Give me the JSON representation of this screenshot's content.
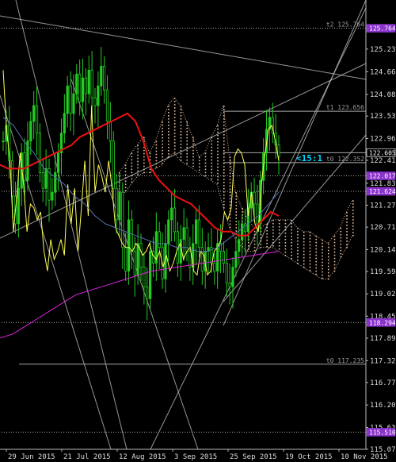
{
  "chart_data": {
    "type": "candlestick",
    "xlabel": "",
    "ylabel": "",
    "ylim": [
      115.075,
      126.4
    ],
    "y_ticks": [
      "125.235",
      "124.660",
      "124.085",
      "123.535",
      "122.965",
      "122.410",
      "121.830",
      "121.270",
      "120.715",
      "120.145",
      "119.590",
      "119.020",
      "118.455",
      "117.895",
      "117.325",
      "116.770",
      "116.200",
      "115.630",
      "115.075"
    ],
    "x_ticks": [
      "29 Jun 2015",
      "21 Jul 2015",
      "12 Aug 2015",
      "3 Sep 2015",
      "25 Sep 2015",
      "19 Oct 2015",
      "10 Nov 2015"
    ],
    "price_tags": [
      {
        "value": 125.764,
        "text": "125.764",
        "color": "#8b33cc"
      },
      {
        "value": 122.605,
        "text": "122.605",
        "color": "#000000"
      },
      {
        "value": 122.017,
        "text": "122.017",
        "color": "#8b33cc"
      },
      {
        "value": 121.624,
        "text": "121.624",
        "color": "#8b33cc"
      },
      {
        "value": 118.294,
        "text": "118.294",
        "color": "#8b33cc"
      },
      {
        "value": 115.51,
        "text": "115.510",
        "color": "#8b33cc"
      }
    ],
    "hlines": [
      {
        "value": 125.764,
        "label": "t2 125.764",
        "style": "dotted"
      },
      {
        "value": 123.656,
        "label": "t1 123.656",
        "style": "solid"
      },
      {
        "value": 122.605,
        "label": "",
        "style": "solid"
      },
      {
        "value": 122.352,
        "label": "t0 122.352",
        "style": "solid"
      },
      {
        "value": 122.017,
        "label": "",
        "style": "dotted"
      },
      {
        "value": 121.624,
        "label": "",
        "style": "dotted"
      },
      {
        "value": 118.294,
        "label": "",
        "style": "dotted"
      },
      {
        "value": 117.235,
        "label": "t0 117.235",
        "style": "solid"
      },
      {
        "value": 115.51,
        "label": "",
        "style": "dotted"
      }
    ],
    "annotation": {
      "text": "<15:1",
      "value": 122.45,
      "color": "#00d8ff"
    },
    "series": [
      {
        "kind": "candles",
        "color": "#22cc22",
        "close": [
          122.9,
          123.3,
          122.4,
          121.5,
          120.8,
          121.7,
          122.6,
          121.9,
          122.9,
          123.4,
          123.8,
          123.1,
          122.1,
          121.7,
          122.2,
          121.4,
          121.6,
          122.1,
          122.6,
          123.1,
          123.6,
          124.3,
          123.6,
          124.1,
          124.6,
          123.9,
          124.5,
          124.1,
          124.7,
          124.0,
          123.8,
          124.3,
          124.8,
          124.2,
          123.4,
          122.9,
          121.7,
          120.9,
          121.6,
          120.2,
          119.6,
          120.9,
          120.1,
          119.5,
          120.3,
          119.7,
          119.2,
          118.9,
          120.1,
          119.8,
          120.6,
          120.2,
          119.4,
          120.3,
          120.9,
          121.2,
          120.6,
          119.8,
          120.4,
          120.7,
          120.1,
          119.7,
          120.3,
          120.9,
          120.2,
          119.6,
          120.1,
          120.2,
          119.8,
          119.6,
          120.3,
          120.1,
          119.8,
          119.3,
          119.2,
          119.7,
          120.1,
          120.4,
          120.8,
          120.6,
          121.2,
          121.6,
          121.3,
          120.8,
          121.9,
          122.6,
          123.2,
          123.5,
          123.1,
          122.8,
          122.5
        ]
      },
      {
        "kind": "line",
        "name": "",
        "color": "#ffff55",
        "values": [
          124.7,
          123.2,
          122.4,
          120.6,
          121.5,
          122.6,
          121.8,
          120.6,
          121.3,
          121.2,
          120.9,
          121.1,
          120.1,
          119.6,
          120.4,
          119.9,
          120.1,
          120.4,
          120.0,
          121.8,
          120.8,
          121.7,
          120.1,
          121.2,
          122.4,
          121.0,
          123.8,
          121.6,
          122.3,
          122.0,
          121.6,
          122.4,
          121.7,
          120.7,
          120.5,
          120.3,
          120.2,
          120.2,
          120.1,
          120.3,
          120.2,
          120.0,
          120.1,
          120.3,
          120.0,
          119.9,
          120.1,
          119.7,
          120.0,
          119.6,
          119.8,
          120.1,
          120.3,
          119.9,
          120.1,
          120.2,
          119.6,
          119.5,
          120.1,
          120.0,
          119.5,
          119.6,
          120.1,
          120.2,
          120.4,
          121.1,
          120.9,
          121.2,
          122.5,
          122.7,
          122.6,
          122.3,
          121.0,
          121.6,
          120.8,
          120.6,
          121.9,
          122.6,
          123.2,
          123.3,
          122.9,
          122.4
        ]
      },
      {
        "kind": "line",
        "name": "",
        "color": "#ee1111",
        "values": [
          122.3,
          122.2,
          122.2,
          122.2,
          122.3,
          122.4,
          122.5,
          122.6,
          122.7,
          122.8,
          123.0,
          123.1,
          123.2,
          123.3,
          123.4,
          123.5,
          123.6,
          123.4,
          122.9,
          122.2,
          121.9,
          121.7,
          121.5,
          121.4,
          121.3,
          121.1,
          120.9,
          120.7,
          120.6,
          120.6,
          120.5,
          120.5,
          120.7,
          120.9,
          121.1,
          121.0
        ]
      },
      {
        "kind": "line",
        "name": "",
        "color": "#dd22dd",
        "values": [
          117.9,
          118.0,
          118.2,
          118.4,
          118.6,
          118.8,
          119.0,
          119.1,
          119.2,
          119.3,
          119.4,
          119.5,
          119.6,
          119.65,
          119.7,
          119.75,
          119.8,
          119.85,
          119.9,
          119.95,
          120.0,
          120.05,
          120.1
        ]
      },
      {
        "kind": "line",
        "name": "",
        "color": "#5c6fb0",
        "values": [
          123.5,
          123.3,
          122.9,
          122.6,
          122.2,
          122.0,
          121.8,
          121.5,
          121.3,
          121.0,
          120.8,
          120.7,
          120.6,
          120.5,
          120.4,
          120.3,
          120.3,
          120.2,
          120.2,
          120.1,
          120.1,
          120.2,
          120.4,
          120.6,
          120.8,
          121.0,
          121.3,
          121.6
        ]
      },
      {
        "kind": "cloud",
        "name": "",
        "color": "#e8c0a0",
        "upper": [
          122.1,
          122.3,
          122.6,
          122.8,
          123.0,
          122.6,
          122.9,
          123.4,
          123.8,
          124.0,
          123.8,
          123.4,
          123.0,
          122.5,
          122.6,
          123.0,
          123.3,
          123.8,
          122.5,
          121.6,
          121.2,
          120.9,
          120.7,
          120.7,
          120.8,
          120.9,
          120.9,
          120.9,
          120.9,
          120.7,
          120.6,
          120.6,
          120.5,
          120.4,
          120.3,
          120.5,
          120.7,
          121.1,
          121.4
        ],
        "lower": [
          121.4,
          121.6,
          121.8,
          122.0,
          122.1,
          122.1,
          122.2,
          122.3,
          122.5,
          122.6,
          122.4,
          122.3,
          122.2,
          122.1,
          122.0,
          121.9,
          121.8,
          121.2,
          120.7,
          120.4,
          120.2,
          120.1,
          120.1,
          120.2,
          120.2,
          120.2,
          120.1,
          120.0,
          119.9,
          119.8,
          119.7,
          119.6,
          119.5,
          119.4,
          119.4,
          119.6,
          119.9,
          120.2,
          120.5
        ]
      }
    ]
  }
}
